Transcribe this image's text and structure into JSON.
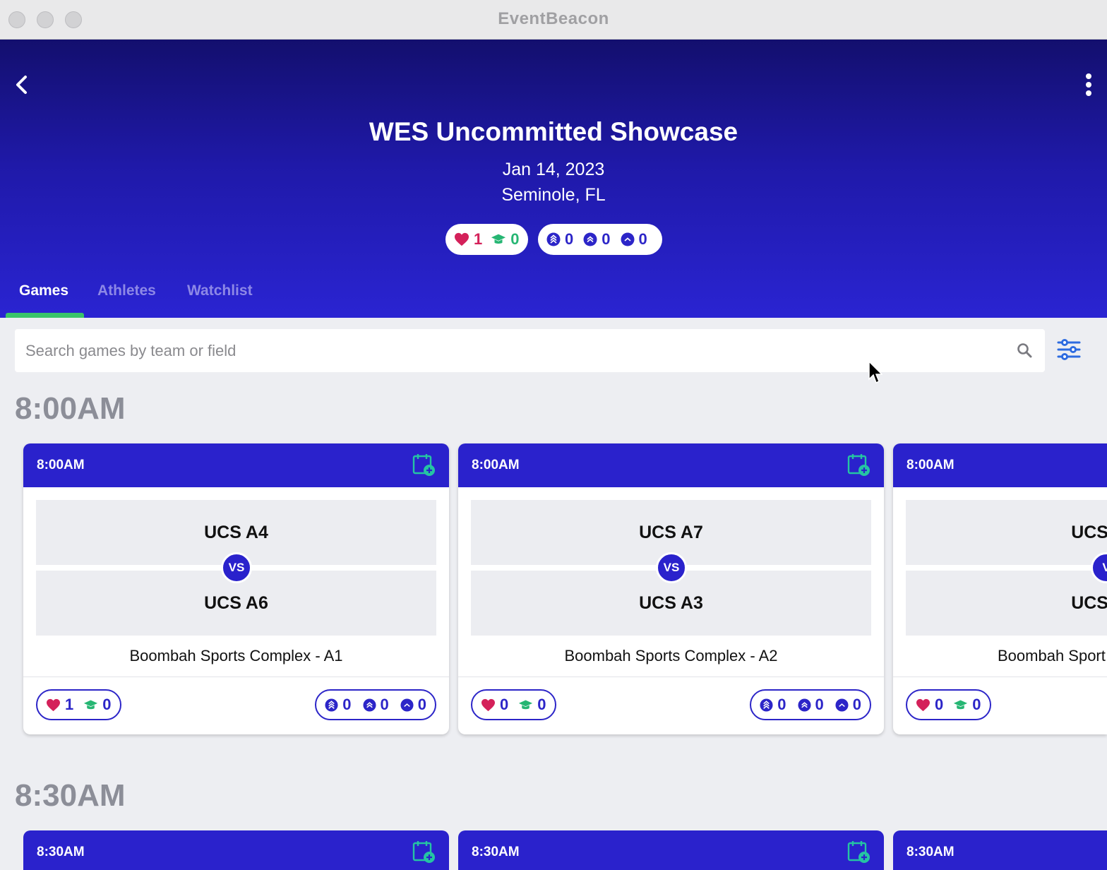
{
  "window": {
    "title": "EventBeacon"
  },
  "event": {
    "title": "WES Uncommitted Showcase",
    "date": "Jan 14, 2023",
    "location": "Seminole, FL",
    "stats": {
      "favorites": "1",
      "commits": "0",
      "level_high": "0",
      "level_mid": "0",
      "level_low": "0"
    }
  },
  "tabs": [
    {
      "label": "Games",
      "active": true
    },
    {
      "label": "Athletes",
      "active": false
    },
    {
      "label": "Watchlist",
      "active": false
    }
  ],
  "search": {
    "placeholder": "Search games by team or field",
    "value": ""
  },
  "sections": [
    {
      "time": "8:00AM",
      "games": [
        {
          "time": "8:00AM",
          "team_a": "UCS A4",
          "team_b": "UCS A6",
          "vs": "VS",
          "venue": "Boombah Sports Complex - A1",
          "favorites": "1",
          "commits": "0",
          "level_high": "0",
          "level_mid": "0",
          "level_low": "0"
        },
        {
          "time": "8:00AM",
          "team_a": "UCS A7",
          "team_b": "UCS A3",
          "vs": "VS",
          "venue": "Boombah Sports Complex - A2",
          "favorites": "0",
          "commits": "0",
          "level_high": "0",
          "level_mid": "0",
          "level_low": "0"
        },
        {
          "time": "8:00AM",
          "team_a": "UCS",
          "team_b": "UCS",
          "vs": "V",
          "venue": "Boombah Sport",
          "favorites": "0",
          "commits": "0"
        }
      ]
    },
    {
      "time": "8:30AM",
      "games": [
        {
          "time": "8:30AM"
        },
        {
          "time": "8:30AM"
        },
        {
          "time": "8:30AM"
        }
      ]
    }
  ],
  "colors": {
    "header_top": "#130f6e",
    "header_bottom": "#2a24d2",
    "accent": "#2a22cc",
    "tab_indicator": "#3ac46a",
    "heart": "#d4215a",
    "cap": "#26b673"
  },
  "icons": [
    "back-chevron-icon",
    "more-vertical-icon",
    "heart-icon",
    "graduation-cap-icon",
    "level-high-icon",
    "level-mid-icon",
    "level-low-icon",
    "search-icon",
    "filter-sliders-icon",
    "calendar-add-icon"
  ]
}
